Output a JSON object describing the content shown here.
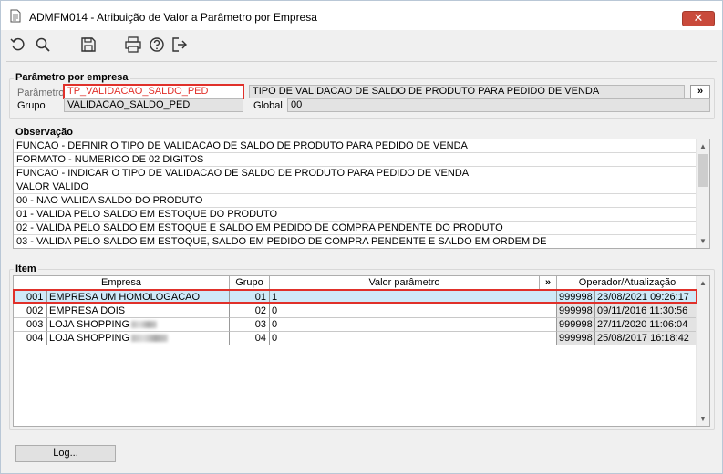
{
  "window": {
    "title": "ADMFM014 - Atribuição de Valor a Parâmetro por Empresa",
    "close_label": "✕"
  },
  "toolbar": {
    "icons": [
      "undo-icon",
      "search-icon",
      "save-icon",
      "print-icon",
      "help-icon",
      "exit-icon"
    ]
  },
  "parametro_section": {
    "title": "Parâmetro por empresa",
    "parametro_label": "Parâmetro",
    "parametro_value": "TP_VALIDACAO_SALDO_PED",
    "parametro_desc": "TIPO DE VALIDACAO DE SALDO DE PRODUTO PARA PEDIDO DE VENDA",
    "expand_label": "»",
    "grupo_label": "Grupo",
    "grupo_value": "VALIDACAO_SALDO_PED",
    "global_label": "Global",
    "global_value": "00"
  },
  "observacao": {
    "title": "Observação",
    "lines": [
      "FUNCAO - DEFINIR O TIPO DE VALIDACAO DE SALDO DE PRODUTO PARA PEDIDO DE VENDA",
      "FORMATO - NUMERICO DE 02 DIGITOS",
      "FUNCAO - INDICAR O TIPO DE VALIDACAO DE SALDO DE PRODUTO PARA PEDIDO DE VENDA",
      "VALOR VALIDO",
      "00 - NAO VALIDA SALDO DO PRODUTO",
      "01 - VALIDA PELO SALDO EM ESTOQUE DO PRODUTO",
      "02 - VALIDA PELO SALDO EM ESTOQUE E SALDO EM PEDIDO DE COMPRA PENDENTE DO PRODUTO",
      "03 - VALIDA PELO SALDO EM ESTOQUE, SALDO EM PEDIDO DE COMPRA PENDENTE  E SALDO EM ORDEM DE"
    ]
  },
  "item": {
    "title": "Item",
    "headers": {
      "empresa": "Empresa",
      "grupo": "Grupo",
      "valor": "Valor parâmetro",
      "expand": "»",
      "operador": "Operador/Atualização"
    },
    "rows": [
      {
        "code": "001",
        "empresa": "EMPRESA UM HOMOLOGACAO",
        "grupo": "01",
        "valor": "1",
        "operador": "999998",
        "data": "23/08/2021 09:26:17"
      },
      {
        "code": "002",
        "empresa": "EMPRESA DOIS",
        "grupo": "02",
        "valor": "0",
        "operador": "999998",
        "data": "09/11/2016 11:30:56"
      },
      {
        "code": "003",
        "empresa": "LOJA SHOPPING",
        "grupo": "03",
        "valor": "0",
        "operador": "999998",
        "data": "27/11/2020 11:06:04"
      },
      {
        "code": "004",
        "empresa": "LOJA SHOPPING",
        "grupo": "04",
        "valor": "0",
        "operador": "999998",
        "data": "25/08/2017 16:18:42"
      }
    ]
  },
  "footer": {
    "log_label": "Log..."
  }
}
